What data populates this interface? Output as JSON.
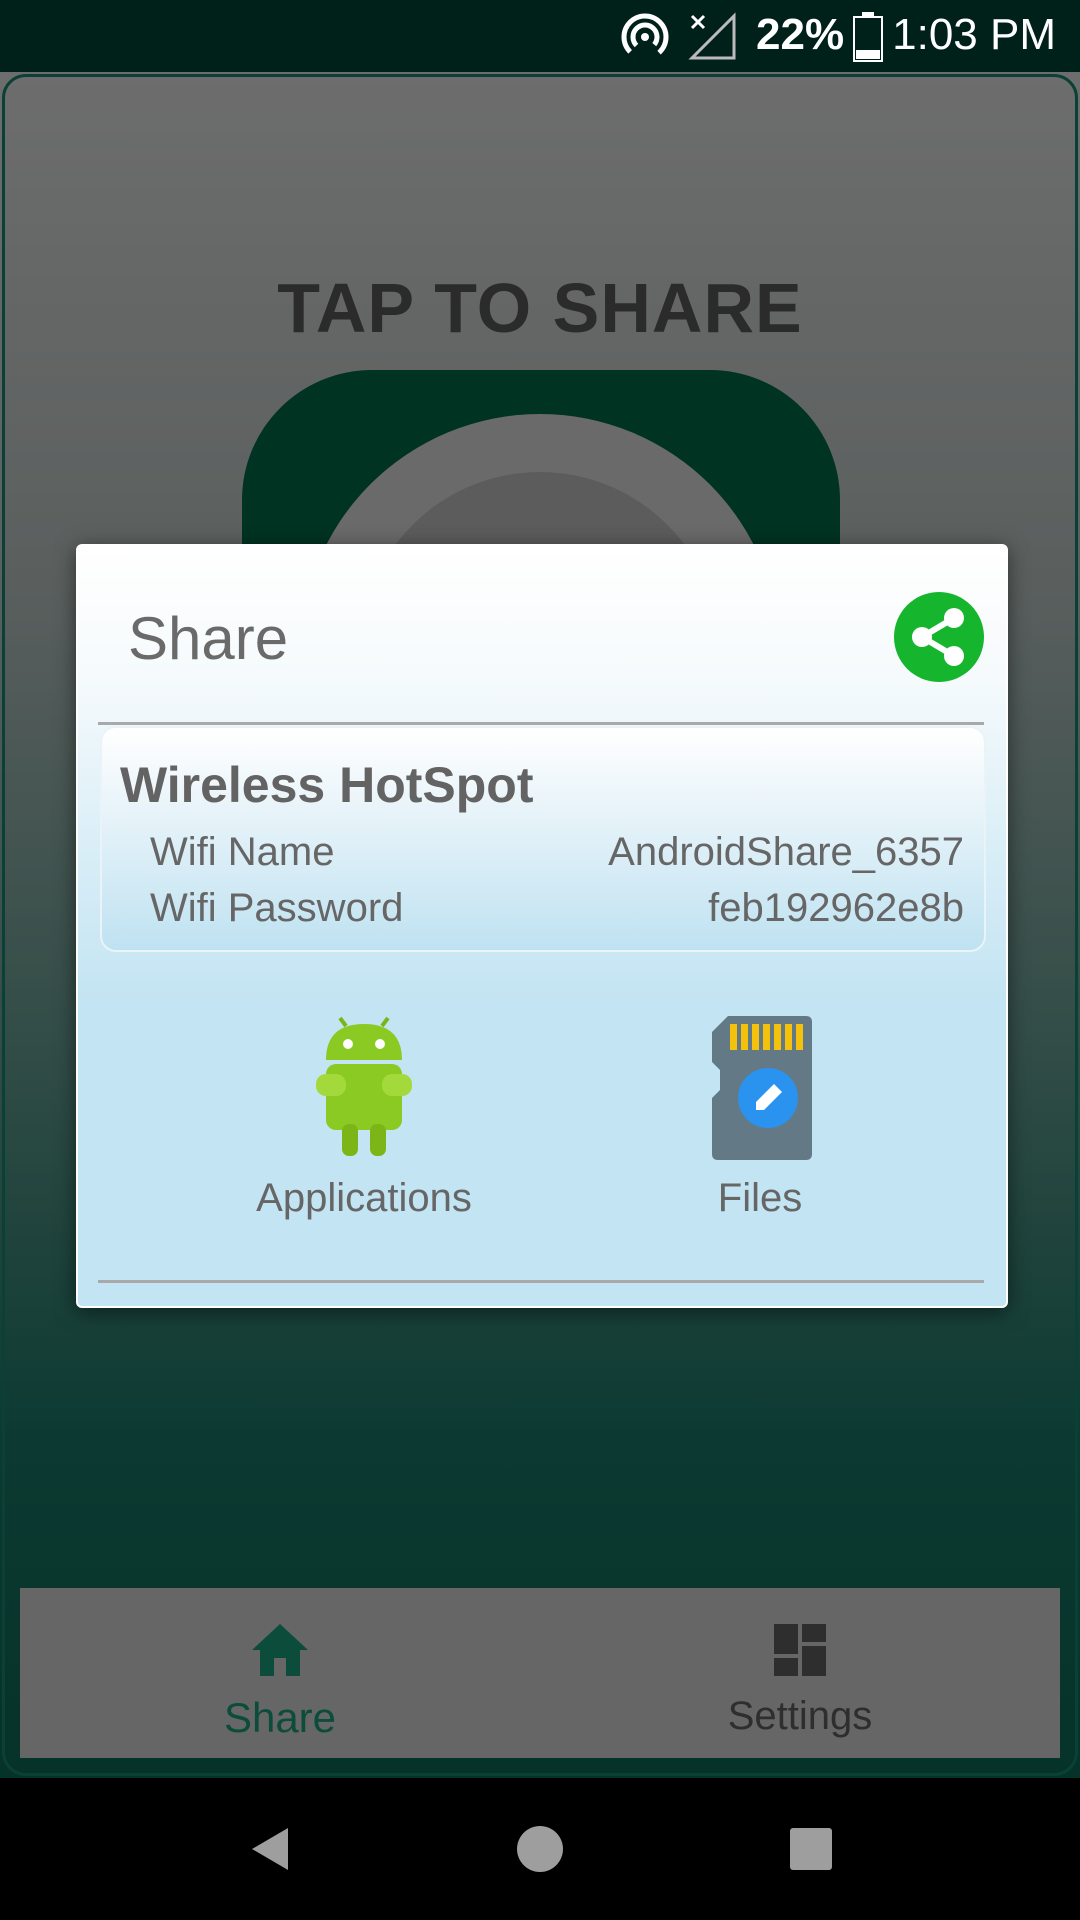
{
  "status_bar": {
    "battery_percent": "22%",
    "time": "1:03 PM",
    "icons": [
      "hotspot-icon",
      "no-signal-icon",
      "battery-icon"
    ]
  },
  "main": {
    "title": "TAP TO SHARE"
  },
  "dialog": {
    "title": "Share",
    "share_icon": "share-icon",
    "hotspot": {
      "heading": "Wireless HotSpot",
      "rows": [
        {
          "label": "Wifi Name",
          "value": "AndroidShare_6357"
        },
        {
          "label": "Wifi Password",
          "value": "feb192962e8b"
        }
      ]
    },
    "actions": [
      {
        "label": "Applications",
        "icon": "android-icon"
      },
      {
        "label": "Files",
        "icon": "sd-card-icon"
      }
    ]
  },
  "bottom_nav": {
    "items": [
      {
        "label": "Share",
        "icon": "home-icon",
        "active": true
      },
      {
        "label": "Settings",
        "icon": "dashboard-icon",
        "active": false
      }
    ],
    "active_color": "#0b4d3a"
  },
  "colors": {
    "status_bar": "#00211a",
    "accent_green": "#15b52d",
    "dialog_blue": "#c3e4f2"
  }
}
